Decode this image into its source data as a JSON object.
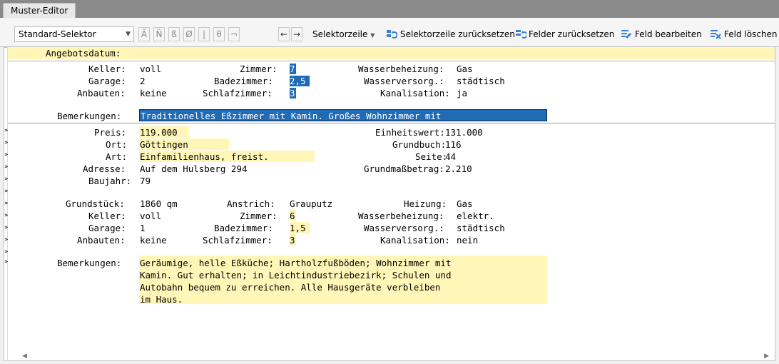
{
  "tab": {
    "label": "Muster-Editor"
  },
  "toolbar": {
    "selector_value": "Standard-Selektor",
    "char_buttons": [
      "Ã",
      "Ñ",
      "ß",
      "Ø",
      "|",
      "θ",
      "¬"
    ],
    "arrow_left": "←",
    "arrow_right": "→",
    "selektorzeile_label": "Selektorzeile",
    "reset_selektorzeile_label": "Selektorzeile zurücksetzen",
    "reset_felder_label": "Felder zurücksetzen",
    "edit_field_label": "Feld bearbeiten",
    "delete_field_label": "Feld löschen"
  },
  "header": {
    "label": "Angebotsdatum:"
  },
  "record1": {
    "keller_label": "Keller:",
    "keller_value": "voll",
    "garage_label": "Garage:",
    "garage_value": "2",
    "anbauten_label": "Anbauten:",
    "anbauten_value": "keine",
    "zimmer_label": "Zimmer:",
    "zimmer_value": "7",
    "badezimmer_label": "Badezimmer:",
    "badezimmer_value": "2,5",
    "schlafzimmer_label": "Schlafzimmer:",
    "schlafzimmer_value": "3",
    "wasserbeheizung_label": "Wasserbeheizung:",
    "wasserbeheizung_value": "Gas",
    "wasserversorg_label": "Wasserversorg.:",
    "wasserversorg_value": "städtisch",
    "kanalisation_label": "Kanalisation:",
    "kanalisation_value": "ja",
    "bemerkungen_label": "Bemerkungen:",
    "bemerkungen_value": "Traditionelles Eßzimmer mit Kamin. Großes Wohnzimmer mit"
  },
  "record2": {
    "preis_label": "Preis:",
    "preis_value": "119.000",
    "ort_label": "Ort:",
    "ort_value": "Göttingen",
    "art_label": "Art:",
    "art_value": "Einfamilienhaus, freist.",
    "adresse_label": "Adresse:",
    "adresse_value": "Auf dem Hulsberg 294",
    "baujahr_label": "Baujahr:",
    "baujahr_value": "79",
    "einheitswert_label": "Einheitswert:",
    "einheitswert_value": "131.000",
    "grundbuch_label": "Grundbuch:",
    "grundbuch_value": "116",
    "seite_label": "Seite:",
    "seite_value": "44",
    "grundmass_label": "Grundmaßbetrag:",
    "grundmass_value": "2.210",
    "grundstueck_label": "Grundstück:",
    "grundstueck_value": "1860 qm",
    "anstrich_label": "Anstrich:",
    "anstrich_value": "Grauputz",
    "heizung_label": "Heizung:",
    "heizung_value": "Gas",
    "keller_label": "Keller:",
    "keller_value": "voll",
    "zimmer_label": "Zimmer:",
    "zimmer_value": "6",
    "wasserbeheizung_label": "Wasserbeheizung:",
    "wasserbeheizung_value": "elektr.",
    "garage_label": "Garage:",
    "garage_value": "1",
    "badezimmer_label": "Badezimmer:",
    "badezimmer_value": "1,5",
    "wasserversorg_label": "Wasserversorg.:",
    "wasserversorg_value": "städtisch",
    "anbauten_label": "Anbauten:",
    "anbauten_value": "keine",
    "schlafzimmer_label": "Schlafzimmer:",
    "schlafzimmer_value": "3",
    "kanalisation_label": "Kanalisation:",
    "kanalisation_value": "nein",
    "bemerkungen_label": "Bemerkungen:",
    "bemerkungen_lines": [
      "Geräumige, helle Eßküche; Hartholzfußböden; Wohnzimmer mit",
      "Kamin. Gut erhalten; in Leichtindustriebezirk; Schulen und",
      "Autobahn bequem zu erreichen. Alle Hausgeräte verbleiben",
      "im Haus."
    ]
  },
  "gutter_marker": "»",
  "colors": {
    "field_highlight": "#fff6b8",
    "selection": "#1f6bb5",
    "tab_bar": "#8a8a8a"
  }
}
